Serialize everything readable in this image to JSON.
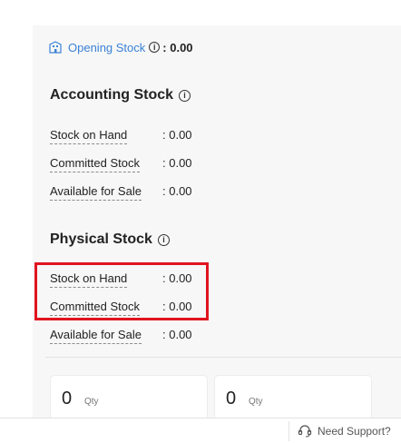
{
  "opening_stock": {
    "icon": "building-icon",
    "label": "Opening Stock",
    "value": ": 0.00"
  },
  "accounting_stock": {
    "title": "Accounting Stock",
    "rows": [
      {
        "label": "Stock on Hand",
        "value": ": 0.00"
      },
      {
        "label": "Committed Stock",
        "value": ": 0.00"
      },
      {
        "label": "Available for Sale",
        "value": ": 0.00"
      }
    ]
  },
  "physical_stock": {
    "title": "Physical Stock",
    "rows": [
      {
        "label": "Stock on Hand",
        "value": ": 0.00"
      },
      {
        "label": "Committed Stock",
        "value": ": 0.00"
      },
      {
        "label": "Available for Sale",
        "value": ": 0.00"
      }
    ]
  },
  "qty_cards": [
    {
      "value": "0",
      "unit": "Qty"
    },
    {
      "value": "0",
      "unit": "Qty"
    }
  ],
  "footer": {
    "support_label": "Need Support?",
    "support_icon": "headset-icon"
  },
  "colors": {
    "link": "#3b82d6",
    "highlight": "#e0141e",
    "panel_bg": "#f7f7f7"
  }
}
